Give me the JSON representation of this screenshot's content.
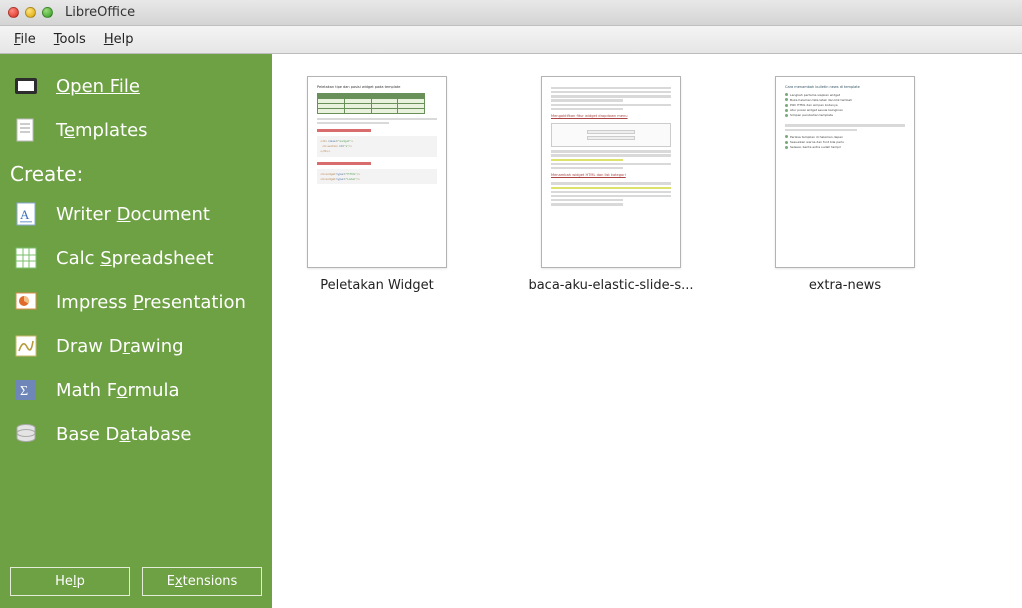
{
  "window": {
    "title": "LibreOffice"
  },
  "menubar": {
    "file": "File",
    "tools": "Tools",
    "help": "Help"
  },
  "sidebar": {
    "open_file": "Open File",
    "templates": "Templates",
    "create_label": "Create:",
    "items": [
      {
        "label": "Writer Document"
      },
      {
        "label": "Calc Spreadsheet"
      },
      {
        "label": "Impress Presentation"
      },
      {
        "label": "Draw Drawing"
      },
      {
        "label": "Math Formula"
      },
      {
        "label": "Base Database"
      }
    ],
    "buttons": {
      "help": "Help",
      "extensions": "Extensions"
    }
  },
  "documents": [
    {
      "label": "Peletakan Widget"
    },
    {
      "label": "baca-aku-elastic-slide-s..."
    },
    {
      "label": "extra-news"
    }
  ]
}
